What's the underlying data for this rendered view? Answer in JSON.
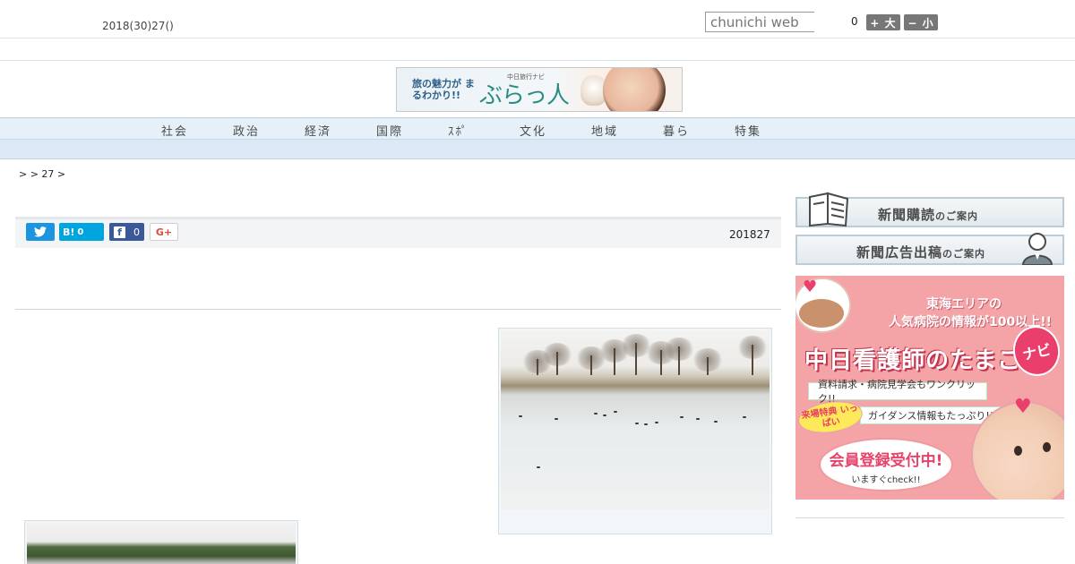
{
  "header": {
    "date": "2018(30)27()",
    "search_placeholder": "chunichi web",
    "font_size_label": "0",
    "font_larger": "+ 大",
    "font_smaller": "− 小"
  },
  "banner": {
    "catch": "旅の魅力が まるわかり!!",
    "subtitle": "中日旅行ナビ",
    "title": "ぶらっ人"
  },
  "nav": {
    "items": [
      "社会",
      "政治",
      "経済",
      "国際",
      "ｽﾎﾟ",
      "文化",
      "地域",
      "暮ら",
      "特集"
    ]
  },
  "breadcrumb": ">  > 27 >",
  "article": {
    "date": "201827",
    "share": {
      "twitter": "",
      "hatena_label": "B!",
      "hatena_count": "0",
      "facebook_count": "0",
      "googleplus": "G+"
    }
  },
  "sidebar": {
    "subscribe_main": "新聞購読",
    "subscribe_small": "のご案内",
    "advertise_main": "新聞広告出稿",
    "advertise_small": "のご案内",
    "ad": {
      "line1": "東海エリアの",
      "line2": "人気病院の情報が100以上!!",
      "title": "中日看護師のたまご",
      "navi": "ナビ",
      "pill1": "資料請求・病院見学会もワンクリック!!",
      "tag": "来場特典 いっぱい",
      "pill2": "ガイダンス情報もたっぷり!!",
      "cta": "会員登録受付中!",
      "cta_sub": "いますぐcheck!!"
    }
  }
}
